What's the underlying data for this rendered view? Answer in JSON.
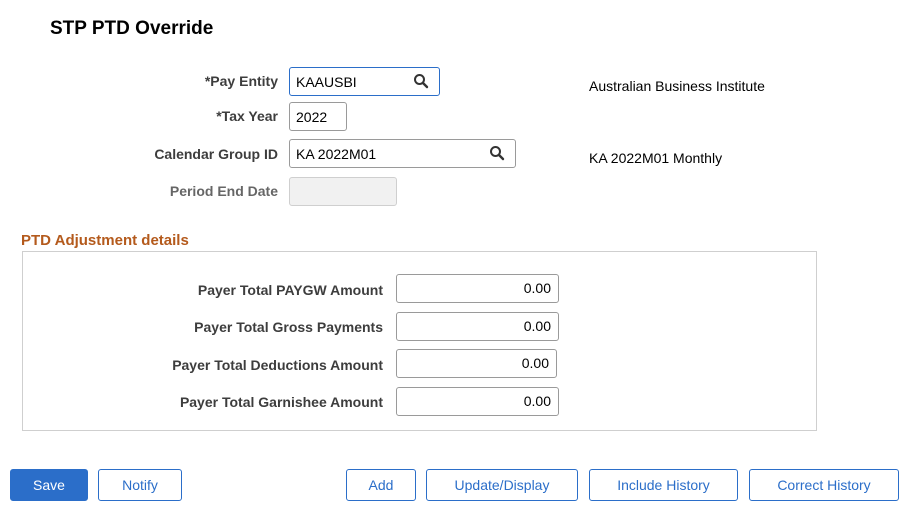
{
  "page": {
    "title": "STP PTD Override"
  },
  "form": {
    "pay_entity": {
      "label": "*Pay Entity",
      "value": "KAAUSBI",
      "description": "Australian Business Institute"
    },
    "tax_year": {
      "label": "*Tax Year",
      "value": "2022"
    },
    "calendar_group": {
      "label": "Calendar Group ID",
      "value": "KA 2022M01",
      "description": "KA 2022M01 Monthly"
    },
    "period_end_date": {
      "label": "Period End Date",
      "value": ""
    }
  },
  "adjustment": {
    "title": "PTD Adjustment details",
    "rows": [
      {
        "label": "Payer Total PAYGW Amount",
        "value": "0.00"
      },
      {
        "label": "Payer Total Gross Payments",
        "value": "0.00"
      },
      {
        "label": "Payer Total Deductions Amount",
        "value": "0.00"
      },
      {
        "label": "Payer Total Garnishee Amount",
        "value": "0.00"
      }
    ]
  },
  "buttons": {
    "save": "Save",
    "notify": "Notify",
    "add": "Add",
    "update_display": "Update/Display",
    "include_history": "Include History",
    "correct_history": "Correct History"
  },
  "colors": {
    "accent": "#2b6ec9",
    "section_title": "#b45a1c"
  },
  "icons": {
    "lookup": "search-icon"
  }
}
